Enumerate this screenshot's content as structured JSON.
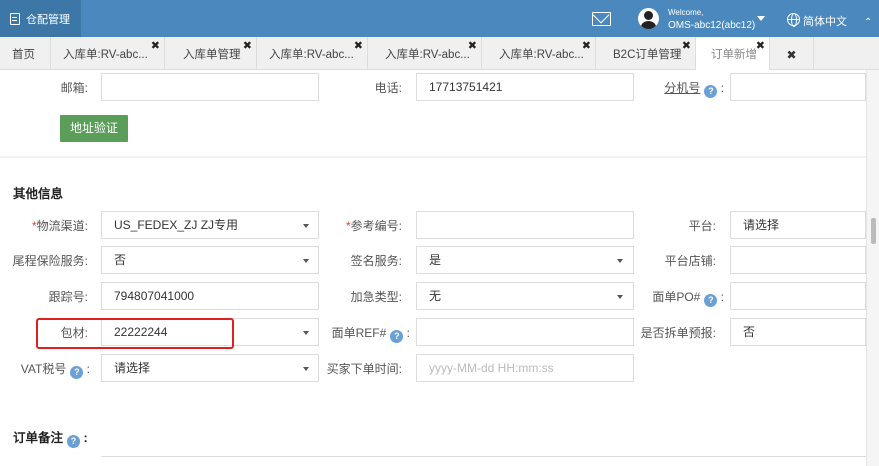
{
  "app": {
    "title": "仓配管理"
  },
  "header": {
    "welcome": "Welcome,",
    "username": "OMS-abc12(abc12)",
    "language": "简体中文"
  },
  "tabs": [
    {
      "label": "首页"
    },
    {
      "label": "入库单:RV-abc..."
    },
    {
      "label": "入库单管理"
    },
    {
      "label": "入库单:RV-abc..."
    },
    {
      "label": "入库单:RV-abc..."
    },
    {
      "label": "入库单:RV-abc..."
    },
    {
      "label": "B2C订单管理"
    },
    {
      "label": "订单新增"
    }
  ],
  "contact": {
    "postcode_label": "邮箱:",
    "postcode_value": "",
    "phone_label": "电话:",
    "phone_value": "17713751421",
    "ext_label": "分机号",
    "ext_value": "",
    "verify_button": "地址验证"
  },
  "other_info": {
    "title": "其他信息",
    "logistics_label": "物流渠道:",
    "logistics_value": "US_FEDEX_ZJ ZJ专用",
    "reference_label": "参考编号:",
    "reference_value": "",
    "platform_label": "平台:",
    "platform_value": "请选择",
    "insurance_label": "尾程保险服务:",
    "insurance_value": "否",
    "signature_label": "签名服务:",
    "signature_value": "是",
    "platform_store_label": "平台店铺:",
    "platform_store_value": "",
    "tracking_label": "跟踪号:",
    "tracking_value": "794807041000",
    "urgent_label": "加急类型:",
    "urgent_value": "无",
    "po_label": "面单PO#",
    "po_value": "",
    "package_label": "包材:",
    "package_value": "22222244",
    "ref_label": "面单REF#",
    "ref_value": "",
    "split_label": "是否拆单预报:",
    "split_value": "否",
    "vat_label": "VAT税号",
    "vat_value": "请选择",
    "buyer_time_label": "买家下单时间:",
    "buyer_time_placeholder": "yyyy-MM-dd HH:mm:ss"
  },
  "order_note": {
    "title": "订单备注"
  },
  "colors": {
    "header": "#4a88bd",
    "brand": "#3c77a8",
    "verify_button": "#5a9e5a",
    "highlight": "#e02020",
    "required": "#e4393c"
  }
}
